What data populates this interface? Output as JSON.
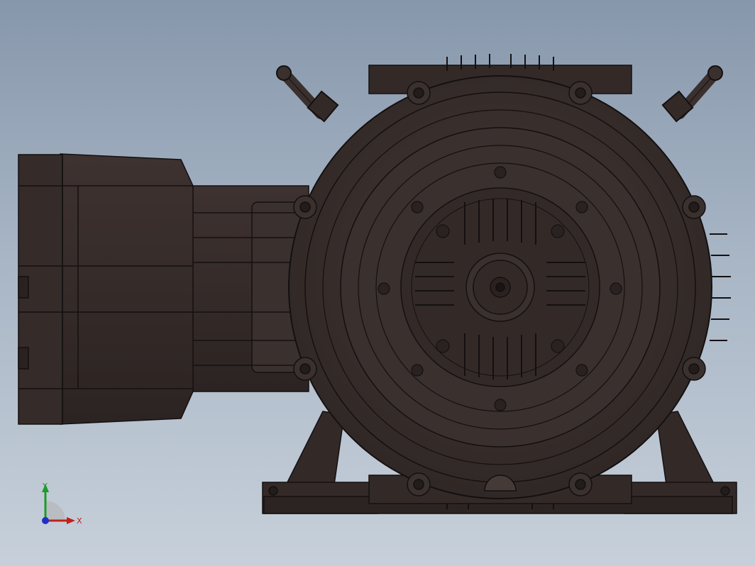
{
  "viewport": {
    "background_top": "#8797ab",
    "background_bottom": "#c7d0da"
  },
  "model": {
    "body_color": "#3a302e",
    "edge_color": "#141010",
    "highlight_color": "#5a4c48"
  },
  "triad": {
    "x_label": "X",
    "y_label": "Y",
    "x_color": "#c0201c",
    "y_color": "#1f9a2a",
    "z_color": "#1f2fc8"
  }
}
